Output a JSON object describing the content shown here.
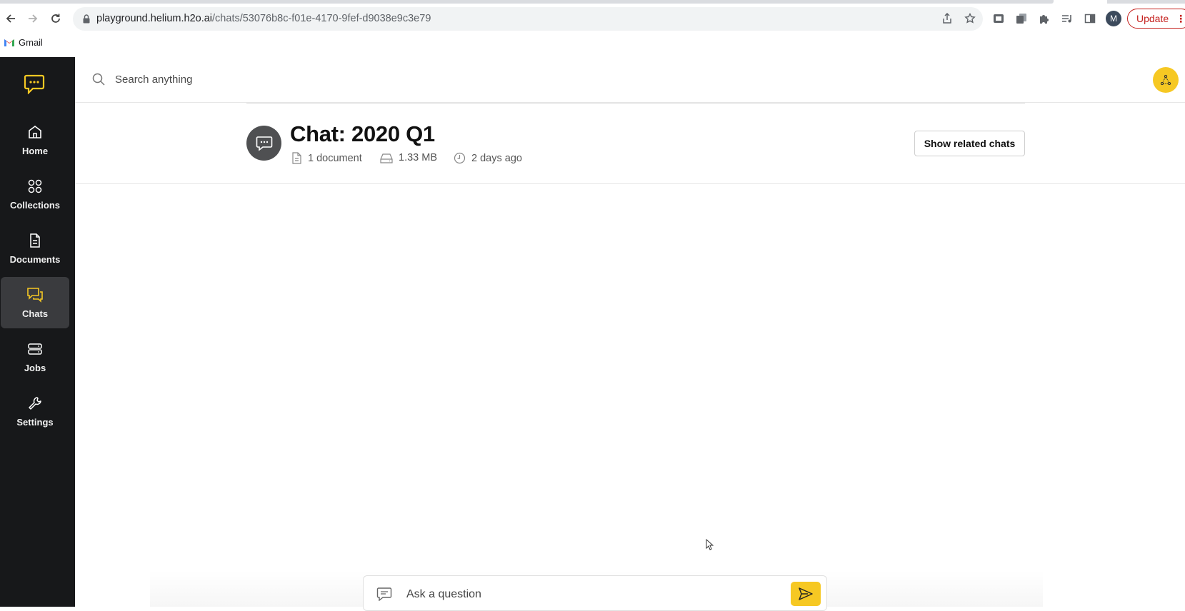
{
  "browser": {
    "url_host": "playground.helium.h2o.ai",
    "url_path": "/chats/53076b8c-f01e-4170-9fef-d9038e9c3e79",
    "profile_initial": "M",
    "update_label": "Update",
    "bookmarks": [
      {
        "label": "Gmail",
        "icon": "gmail-icon"
      }
    ]
  },
  "sidebar": {
    "items": [
      {
        "label": "Home",
        "icon": "home-icon"
      },
      {
        "label": "Collections",
        "icon": "collections-icon"
      },
      {
        "label": "Documents",
        "icon": "document-icon"
      },
      {
        "label": "Chats",
        "icon": "chats-icon",
        "active": true
      },
      {
        "label": "Jobs",
        "icon": "jobs-icon"
      },
      {
        "label": "Settings",
        "icon": "wrench-icon"
      }
    ]
  },
  "search": {
    "placeholder": "Search anything"
  },
  "chat": {
    "title": "Chat: 2020 Q1",
    "documents": "1 document",
    "size": "1.33 MB",
    "updated": "2 days ago",
    "related_button": "Show related chats"
  },
  "composer": {
    "placeholder": "Ask a question"
  },
  "colors": {
    "accent": "#f6c823",
    "sidebar_bg": "#17181a",
    "active_item": "#3a3b3e"
  }
}
